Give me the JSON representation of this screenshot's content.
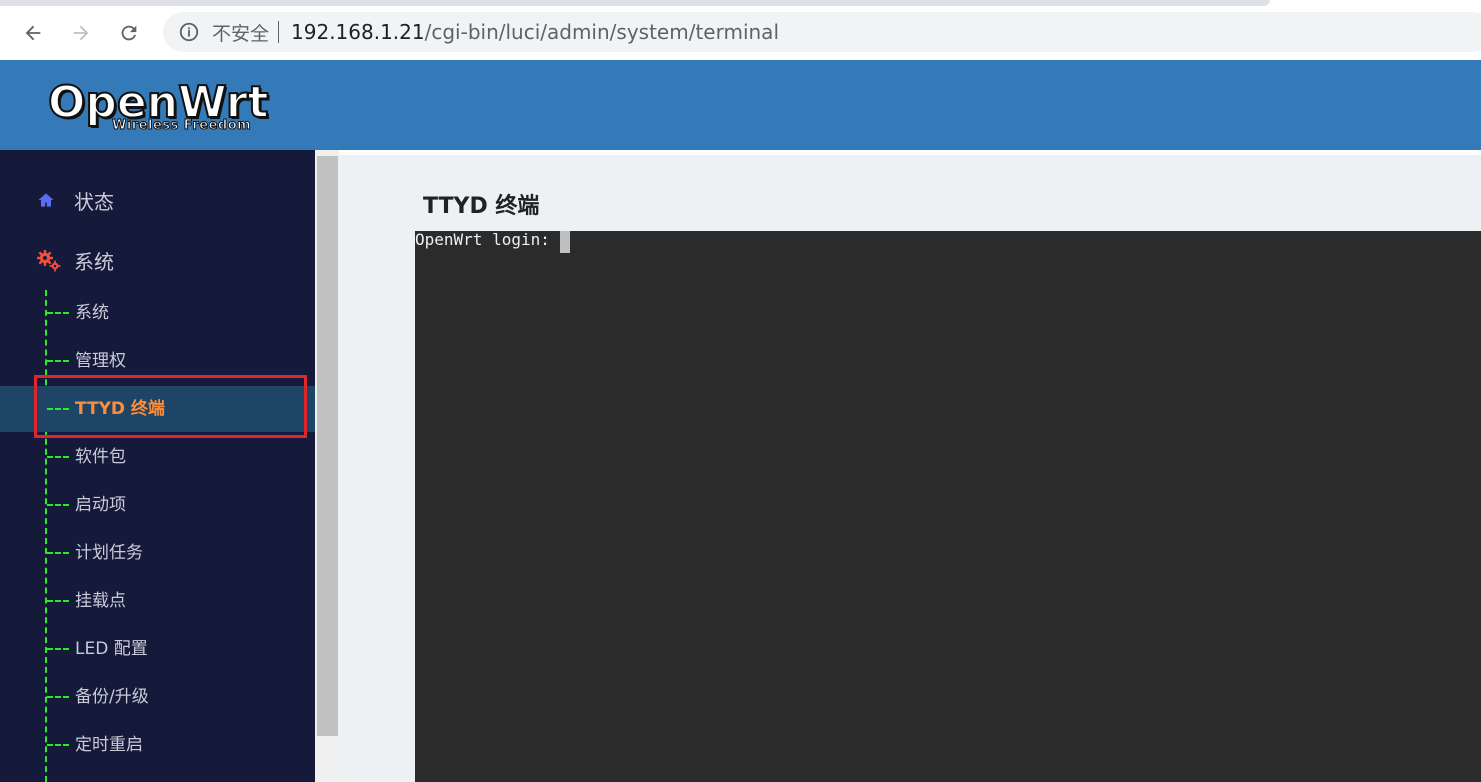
{
  "browser": {
    "security_label": "不安全",
    "url_host": "192.168.1.21",
    "url_path": "/cgi-bin/luci/admin/system/terminal"
  },
  "header": {
    "logo_main": "OpenWrt",
    "logo_sub": "Wireless Freedom",
    "background_color": "#357ab8"
  },
  "sidebar": {
    "top_items": [
      {
        "label": "状态",
        "icon": "home-icon"
      },
      {
        "label": "系统",
        "icon": "gears-icon"
      }
    ],
    "sub_items": [
      {
        "label": "系统"
      },
      {
        "label": "管理权"
      },
      {
        "label": "TTYD 终端",
        "active": true
      },
      {
        "label": "软件包"
      },
      {
        "label": "启动项"
      },
      {
        "label": "计划任务"
      },
      {
        "label": "挂载点"
      },
      {
        "label": "LED 配置"
      },
      {
        "label": "备份/升级"
      },
      {
        "label": "定时重启"
      }
    ],
    "active_color": "#ff8c3a",
    "highlight_color": "#e0262d"
  },
  "main": {
    "title": "TTYD 终端",
    "terminal_prompt": "OpenWrt login: "
  }
}
